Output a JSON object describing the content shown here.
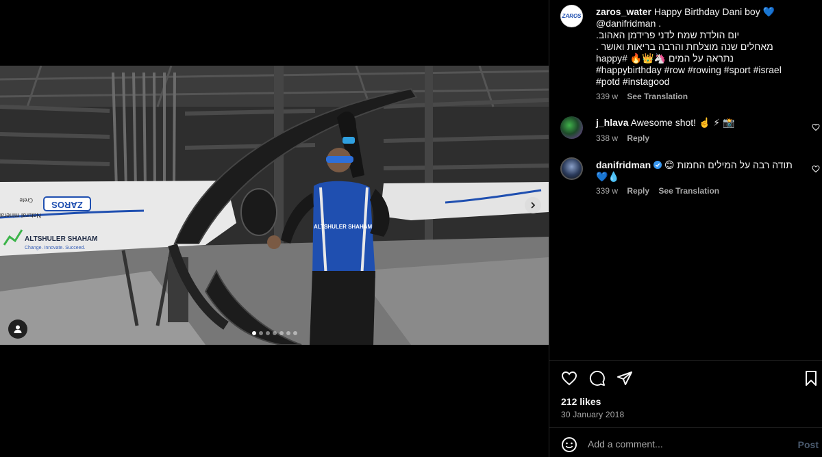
{
  "media": {
    "slide_count": 7,
    "active_slide": 1,
    "boat_text_1": "ALTSHULER SHAHAM",
    "boat_text_2": "Change. Innovate. Succeed.",
    "boat_logo": "ZAROS",
    "boat_text_3": "Natural mineral wa",
    "boat_text_4": "Crete",
    "jersey_text": "ALTSHULER SHAHAM"
  },
  "caption": {
    "avatar_text": "ZAROS",
    "username": "zaros_water",
    "text": "Happy Birthday Dani boy 💙",
    "line2": "@danifridman .",
    "line3": "יום הולדת שמח לדני פרידמן האהוב.",
    "line4": "מאחלים שנה מוצלחת והרבה בריאות ואושר .",
    "line5": "נתראה על המים 🦄👑🔥 #happy",
    "line6": "#happybirthday #row #rowing #sport #israel",
    "line7": "#potd #instagood",
    "time": "339 w",
    "see_translation": "See Translation"
  },
  "comments": [
    {
      "username": "j_hlava",
      "text": "Awesome shot! ☝️ ⚡ 📸",
      "time": "338 w",
      "reply": "Reply"
    },
    {
      "username": "danifridman",
      "text": "תודה רבה על המילים החמות 😊",
      "text2": "💙💧",
      "time": "339 w",
      "reply": "Reply",
      "see_translation": "See Translation"
    }
  ],
  "post": {
    "likes": "212 likes",
    "date": "30 January 2018"
  },
  "comment_box": {
    "placeholder": "Add a comment...",
    "post_label": "Post"
  },
  "icons": [
    "heart-icon",
    "comment-icon",
    "share-icon",
    "bookmark-icon",
    "emoji-icon",
    "chevron-right-icon",
    "user-tag-icon",
    "verified-badge-icon"
  ],
  "colors": {
    "background": "#000000",
    "text": "#f5f5f5",
    "muted": "#a8a8a8",
    "verified": "#3897f0",
    "post_disabled": "#4a5a6e",
    "jersey_blue": "#1f4fb0"
  }
}
